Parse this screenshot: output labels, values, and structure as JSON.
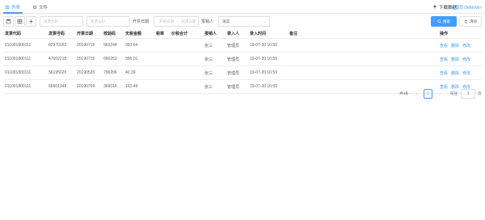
{
  "tabs": [
    {
      "label": "列表",
      "icon": "list-icon"
    },
    {
      "label": "文件",
      "icon": "gear-icon"
    }
  ],
  "topbar": {
    "link_label": "下载数据",
    "user_label": "管理员 DeMoVer"
  },
  "toolbar": {
    "invoice_code_placeholder": "发票代码",
    "invoice_number_placeholder": "发票号码",
    "date_label": "开票日期",
    "date_start_placeholder": "开始日期",
    "date_separator": "-",
    "date_end_placeholder": "结束日期",
    "reimburse_label": "报销人",
    "status_value": "请选",
    "search_label": "搜索",
    "clear_label": "清除"
  },
  "table": {
    "columns": [
      "发票代码",
      "发票号码",
      "开票日期",
      "校验码",
      "无税金额",
      "税率",
      "价税合计",
      "报销人",
      "录入人",
      "录入时间",
      "备注",
      "操作"
    ],
    "rows": [
      {
        "code": "011001800111",
        "number": "82970162",
        "date": "20190715",
        "check": "663244",
        "amount": "393.64",
        "tax": "",
        "total": "",
        "reimburser": "张三",
        "entered_by": "管理员",
        "entered_at": "19-07-20 16:59",
        "remark": ""
      },
      {
        "code": "011001800111",
        "number": "47602218",
        "date": "20190715",
        "check": "660263",
        "amount": "395.01",
        "tax": "",
        "total": "",
        "reimburser": "张三",
        "entered_by": "管理员",
        "entered_at": "19-07-20 16:59",
        "remark": ""
      },
      {
        "code": "011001800111",
        "number": "56195020",
        "date": "20190520",
        "check": "796206",
        "amount": "40.39",
        "tax": "",
        "total": "",
        "reimburser": "张三",
        "entered_by": "管理员",
        "entered_at": "19-07-20 16:59",
        "remark": ""
      },
      {
        "code": "011001800111",
        "number": "66601348",
        "date": "20190709",
        "check": "366016",
        "amount": "163.49",
        "tax": "",
        "total": "",
        "reimburser": "张三",
        "entered_by": "管理员",
        "entered_at": "19-07-20 16:59",
        "remark": ""
      }
    ],
    "actions": [
      "查看",
      "删除",
      "修改"
    ]
  },
  "pagination": {
    "total_label": "共4条",
    "current_page": "1",
    "goto_label": "前往",
    "goto_value": "1",
    "page_label": "页"
  },
  "colors": {
    "primary": "#409eff",
    "border": "#dcdfe6",
    "row_border": "#ebeef5",
    "text": "#606266"
  }
}
